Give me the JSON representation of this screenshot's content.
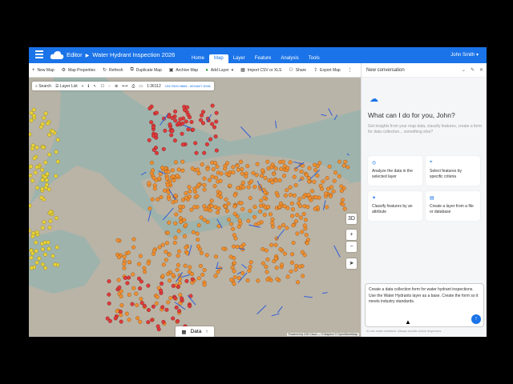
{
  "header": {
    "app_name": "Editor",
    "map_name": "Water Hydrant Inspection 2026",
    "menus": [
      "Home",
      "Map",
      "Layer",
      "Feature",
      "Analysis",
      "Tools"
    ],
    "active_menu": "Map",
    "user": "John Smith"
  },
  "toolbar": {
    "items": [
      {
        "icon": "plus-icon",
        "label": "New Map"
      },
      {
        "icon": "gear-icon",
        "label": "Map Properties"
      },
      {
        "icon": "refresh-icon",
        "label": "Refresh"
      },
      {
        "icon": "duplicate-icon",
        "label": "Duplicate Map"
      },
      {
        "icon": "archive-icon",
        "label": "Archive Map"
      },
      {
        "icon": "add-layer-icon",
        "label": "Add Layer"
      },
      {
        "icon": "table-icon",
        "label": "Import CSV or XLS"
      },
      {
        "icon": "share-icon",
        "label": "Share"
      },
      {
        "icon": "export-icon",
        "label": "Export Map"
      }
    ]
  },
  "map": {
    "search_label": "Search",
    "layer_list_label": "Layer List",
    "scale": "1:36112",
    "coords": "19470020.8866 , 6034627.8108",
    "data_button": "Data",
    "zoom_3d": "3D",
    "attribution": "Powered by GIS Cloud — © Mapbox © OpenStreetMap",
    "colors": {
      "water": "#9fb3ad",
      "land": "#b9b4a8",
      "hydrant_orange": "#f09030",
      "hydrant_red": "#e03a3a",
      "hydrant_yellow": "#e8d23a",
      "pipe_blue": "#2f5ed8"
    }
  },
  "chat": {
    "header": "New conversation",
    "greeting": "What can I do for you, John?",
    "subtitle": "Get insights from your map data, classify features, create a form for data collection... something else?",
    "cards": [
      {
        "icon": "analyze-icon",
        "text": "Analyze the data in the selected layer"
      },
      {
        "icon": "select-icon",
        "text": "Select features by specific criteria"
      },
      {
        "icon": "classify-icon",
        "text": "Classify features by an attribute"
      },
      {
        "icon": "layer-file-icon",
        "text": "Create a layer from a file or database"
      }
    ],
    "input_text": "Create a data collection form for water hydrant inspections. Use the Water Hydrants layer as a base. Create the form so it meets industry standards.",
    "disclaimer": "AI can make mistakes. Always double-check responses."
  }
}
